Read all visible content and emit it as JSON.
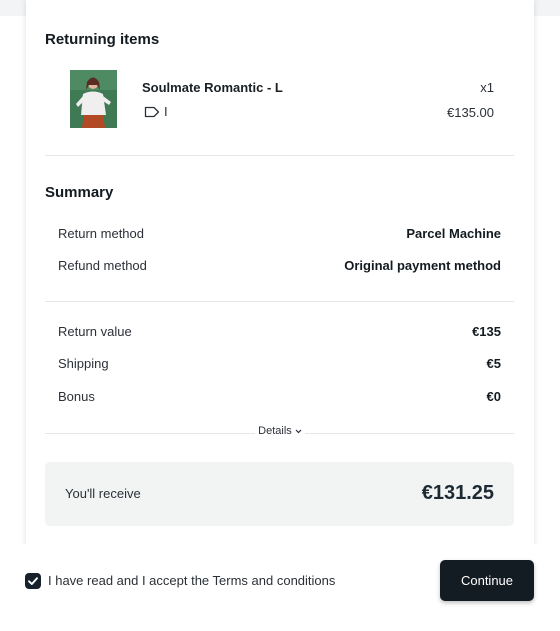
{
  "returning": {
    "title": "Returning items",
    "item": {
      "name": "Soulmate Romantic - L",
      "tag_separator": "I",
      "quantity": "x1",
      "price": "€135.00"
    }
  },
  "summary": {
    "title": "Summary",
    "return_method_label": "Return method",
    "return_method_value": "Parcel Machine",
    "refund_method_label": "Refund method",
    "refund_method_value": "Original payment method",
    "return_value_label": "Return value",
    "return_value": "€135",
    "shipping_label": "Shipping",
    "shipping_value": "€5",
    "bonus_label": "Bonus",
    "bonus_value": "€0",
    "details_label": "Details",
    "receive_label": "You'll receive",
    "receive_value": "€131.25"
  },
  "footer": {
    "terms_checked": true,
    "terms_label": "I have read and I accept the Terms and conditions",
    "continue_label": "Continue"
  },
  "colors": {
    "primary_button": "#131b23",
    "receive_box": "#f2f4f4"
  }
}
